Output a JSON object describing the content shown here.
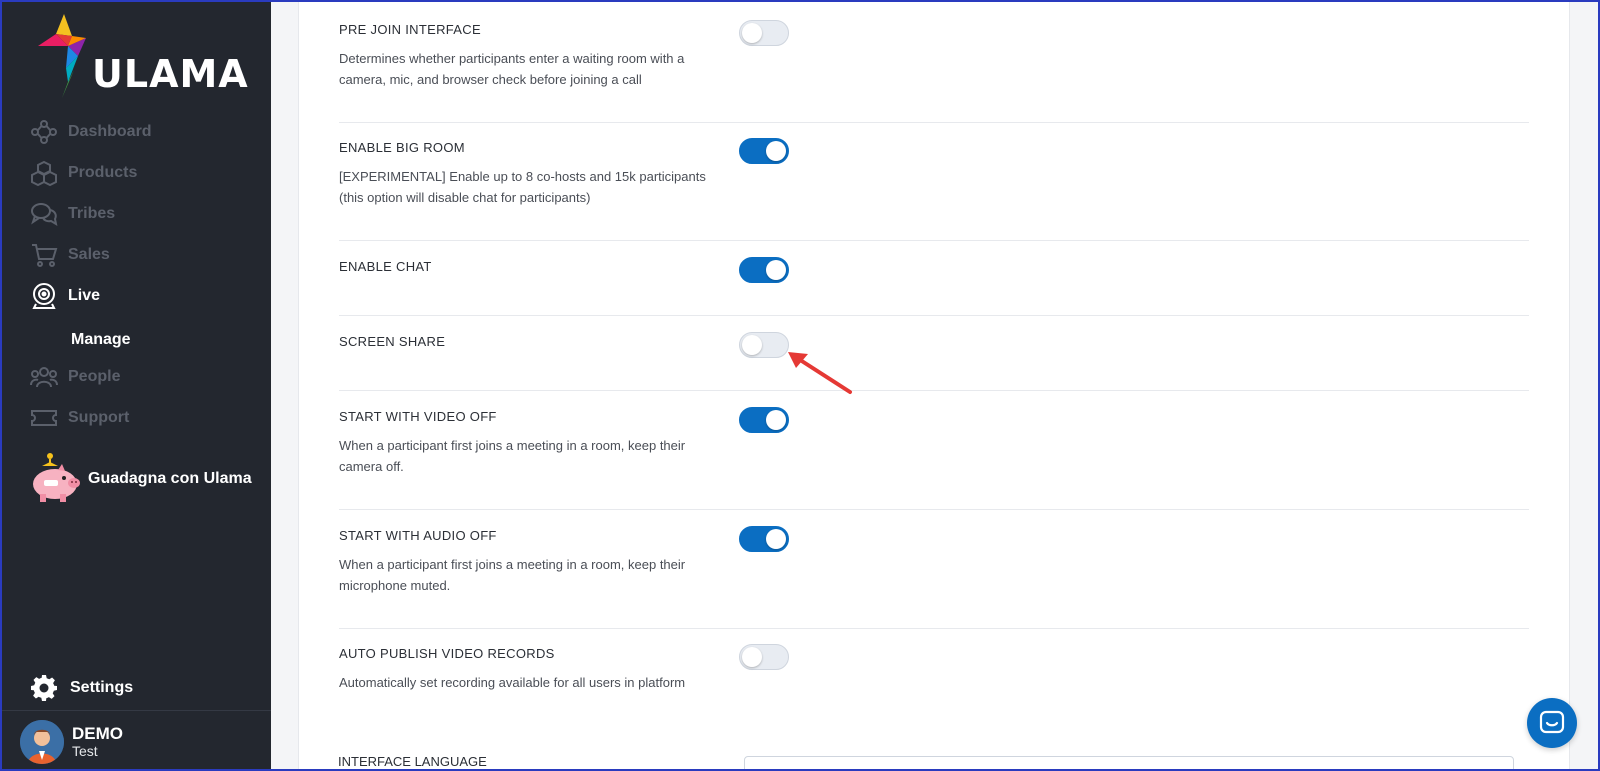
{
  "brand": {
    "name": "ULAMA"
  },
  "sidebar": {
    "items": [
      {
        "label": "Dashboard",
        "icon": "network-icon",
        "active": false
      },
      {
        "label": "Products",
        "icon": "cubes-icon",
        "active": false
      },
      {
        "label": "Tribes",
        "icon": "chat-bubbles-icon",
        "active": false
      },
      {
        "label": "Sales",
        "icon": "cart-icon",
        "active": false
      },
      {
        "label": "Live",
        "icon": "webcam-icon",
        "active": true
      },
      {
        "label": "People",
        "icon": "people-icon",
        "active": false
      },
      {
        "label": "Support",
        "icon": "ticket-icon",
        "active": false
      }
    ],
    "sub_item": "Manage",
    "promo_label": "Guadagna con Ulama",
    "settings_label": "Settings",
    "user": {
      "name": "DEMO",
      "role": "Test"
    }
  },
  "settings": [
    {
      "title": "PRE JOIN INTERFACE",
      "desc": "Determines whether participants enter a waiting room with a camera, mic, and browser check before joining a call",
      "enabled": false
    },
    {
      "title": "ENABLE BIG ROOM",
      "desc": "[EXPERIMENTAL] Enable up to 8 co-hosts and 15k participants (this option will disable chat for participants)",
      "enabled": true
    },
    {
      "title": "ENABLE CHAT",
      "desc": "",
      "enabled": true
    },
    {
      "title": "SCREEN SHARE",
      "desc": "",
      "enabled": false
    },
    {
      "title": "START WITH VIDEO OFF",
      "desc": "When a participant first joins a meeting in a room, keep their camera off.",
      "enabled": true
    },
    {
      "title": "START WITH AUDIO OFF",
      "desc": "When a participant first joins a meeting in a room, keep their microphone muted.",
      "enabled": true
    },
    {
      "title": "AUTO PUBLISH VIDEO RECORDS",
      "desc": "Automatically set recording available for all users in platform",
      "enabled": false
    }
  ],
  "interface_language_label": "INTERFACE LANGUAGE",
  "colors": {
    "accent": "#0b6ec2",
    "sidebar_bg": "#23272f",
    "arrow": "#e53935"
  }
}
